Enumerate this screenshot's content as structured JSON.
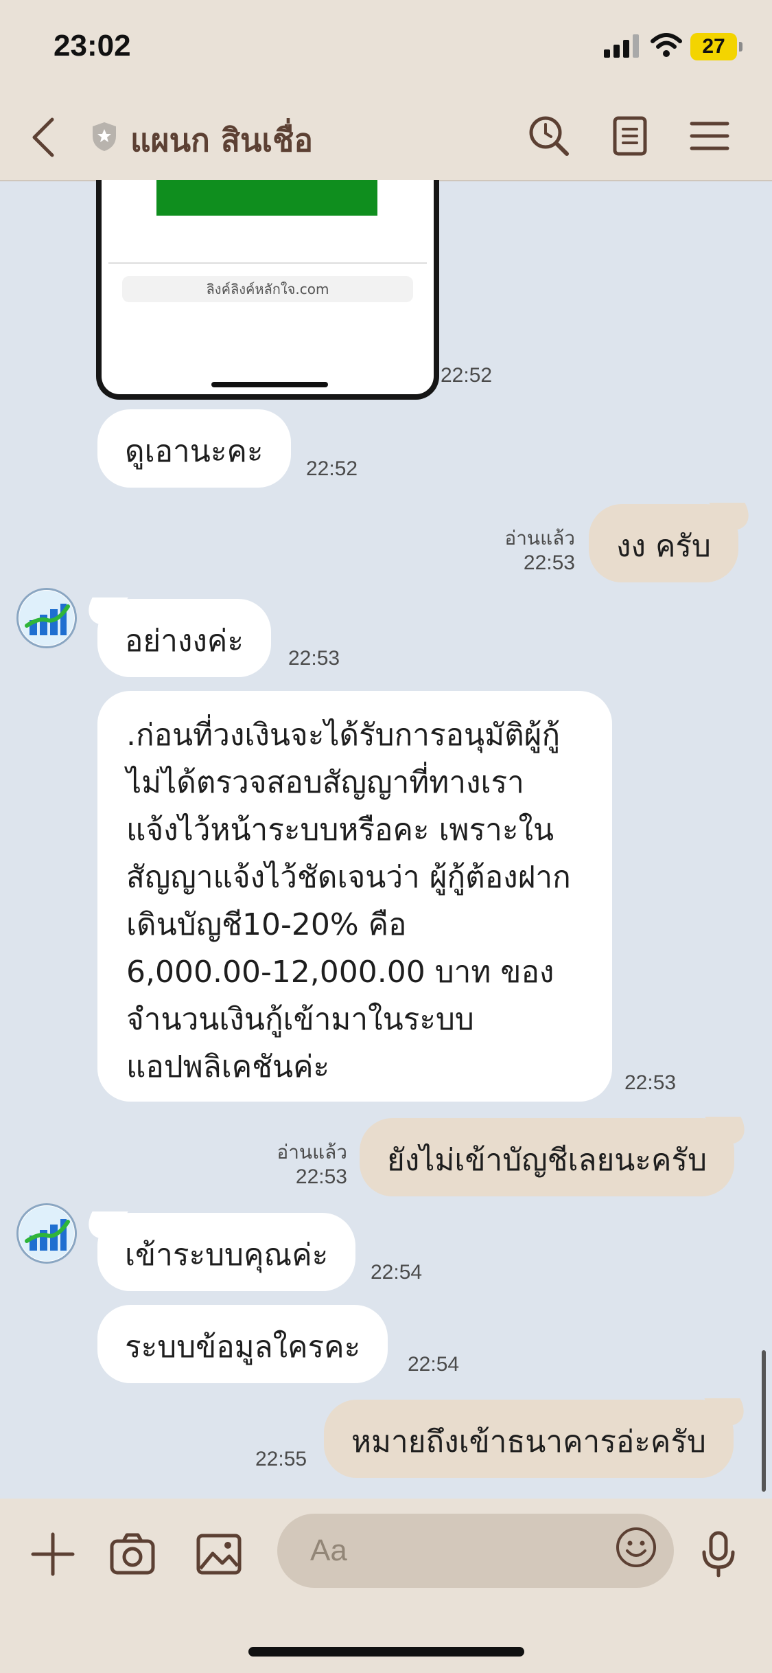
{
  "status_bar": {
    "time": "23:02",
    "battery": "27"
  },
  "header": {
    "title": "แผนก สินเชื่อ"
  },
  "image_message": {
    "url_text": "ลิงค์ลิงค์หลักใจ.com",
    "time": "22:52"
  },
  "messages": [
    {
      "id": "m1",
      "side": "in",
      "text": "ดูเอานะคะ",
      "time": "22:52"
    },
    {
      "id": "m2",
      "side": "out",
      "text": "งง ครับ",
      "read": "อ่านแล้ว",
      "time": "22:53"
    },
    {
      "id": "m3",
      "side": "in",
      "text": "อย่างงค่ะ",
      "time": "22:53"
    },
    {
      "id": "m4",
      "side": "in",
      "lines": [
        ".ก่อนที่วงเงินจะได้รับการอนุมัติผู้กู้",
        "ไม่ได้ตรวจสอบสัญญาที่ทางเรา",
        "แจ้งไว้หน้าระบบหรือคะ เพราะใน",
        "สัญญาแจ้งไว้ชัดเจนว่า ผู้กู้ต้องฝาก",
        "เดินบัญชี10-20% คือ",
        "6,000.00-12,000.00 บาท ของ",
        "จำนวนเงินกู้เข้ามาในระบบ",
        "แอปพลิเคชันค่ะ"
      ],
      "time": "22:53"
    },
    {
      "id": "m5",
      "side": "out",
      "text": "ยังไม่เข้าบัญชีเลยนะครับ",
      "read": "อ่านแล้ว",
      "time": "22:53"
    },
    {
      "id": "m6",
      "side": "in",
      "text": "เข้าระบบคุณค่ะ",
      "time": "22:54"
    },
    {
      "id": "m7",
      "side": "in",
      "text": "ระบบข้อมูลใครคะ",
      "time": "22:54"
    },
    {
      "id": "m8",
      "side": "out",
      "text": "หมายถึงเข้าธนาคารอ่ะครับ",
      "time": "22:55"
    }
  ],
  "input": {
    "placeholder": "Aa"
  },
  "colors": {
    "header_bg": "#e9e1d7",
    "chat_bg": "#dde4ed",
    "out_bubble": "#e8dccd",
    "in_bubble": "#ffffff",
    "title": "#5c4033"
  }
}
